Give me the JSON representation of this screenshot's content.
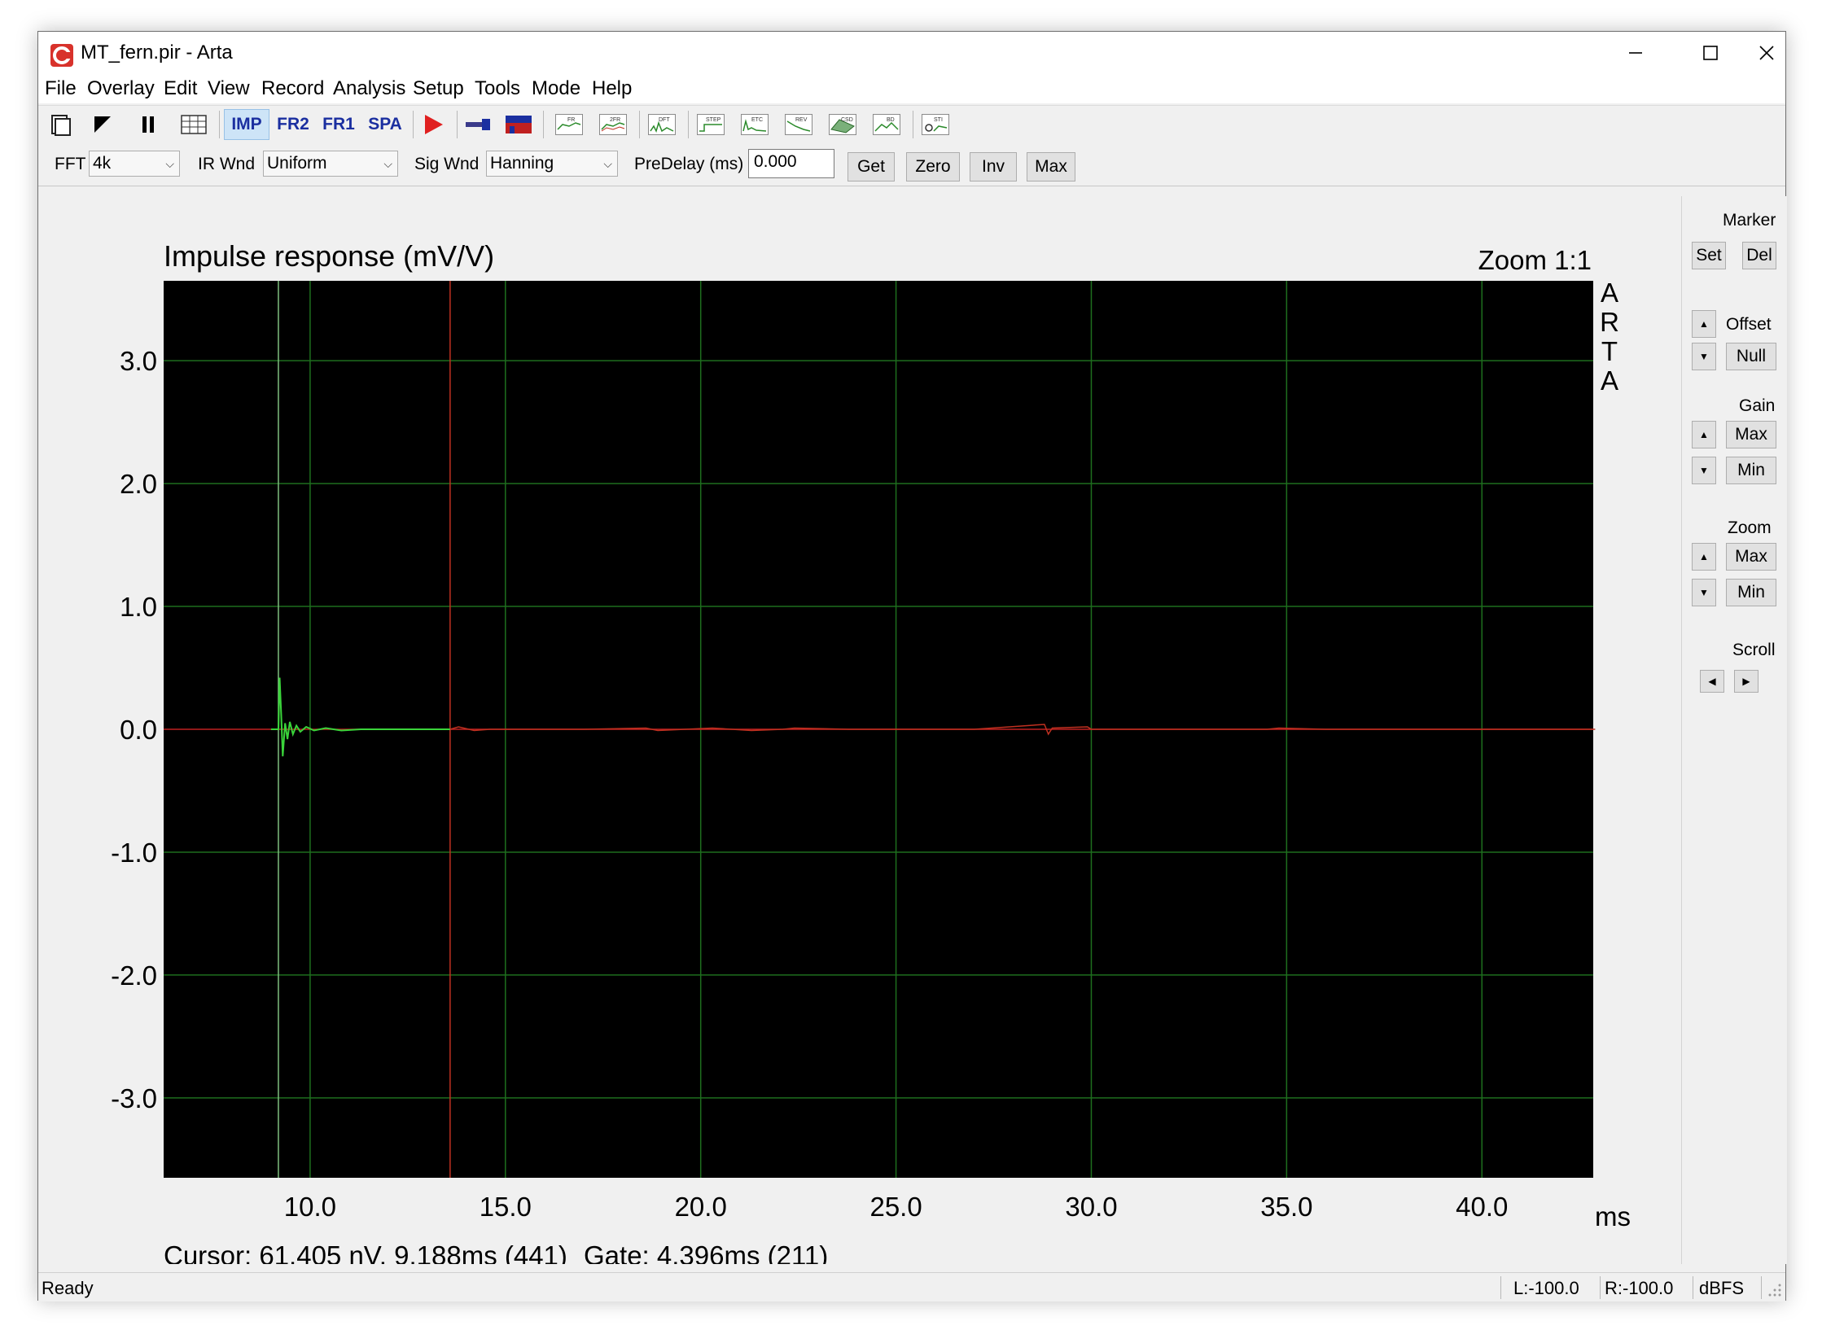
{
  "window": {
    "title": "MT_fern.pir - Arta"
  },
  "menu": [
    "File",
    "Overlay",
    "Edit",
    "View",
    "Record",
    "Analysis",
    "Setup",
    "Tools",
    "Mode",
    "Help"
  ],
  "toolbar": {
    "mode_buttons": [
      "IMP",
      "FR2",
      "FR1",
      "SPA"
    ],
    "active_mode": "IMP",
    "chart_buttons": [
      "FR",
      "2FR",
      "DFT",
      "STEP",
      "ETC",
      "REV",
      "CSD",
      "BD",
      "STI"
    ]
  },
  "params": {
    "fft_label": "FFT",
    "fft_value": "4k",
    "irwnd_label": "IR Wnd",
    "irwnd_value": "Uniform",
    "sigwnd_label": "Sig Wnd",
    "sigwnd_value": "Hanning",
    "predelay_label": "PreDelay (ms)",
    "predelay_value": "0.000",
    "get": "Get",
    "zero": "Zero",
    "inv": "Inv",
    "max": "Max"
  },
  "plot": {
    "title": "Impulse response (mV/V)",
    "zoom": "Zoom 1:1",
    "x_unit": "ms",
    "watermark": [
      "A",
      "R",
      "T",
      "A"
    ],
    "cursor_readout": "Cursor: 61.405 nV, 9.188ms (441)",
    "gate_readout": "Gate: 4.396ms (211)",
    "colors": {
      "background": "#000000",
      "grid": "#1e6e1e",
      "pre_gate": "#3ad43a",
      "post_gate": "#c03020",
      "axis_zero": "#c02020"
    }
  },
  "chart_data": {
    "type": "line",
    "title": "Impulse response (mV/V)",
    "xlabel": "ms",
    "ylabel": "",
    "xlim": [
      6.25,
      42.85
    ],
    "ylim": [
      -3.65,
      3.65
    ],
    "x_ticks": [
      "10.0",
      "15.0",
      "20.0",
      "25.0",
      "30.0",
      "35.0",
      "40.0"
    ],
    "y_ticks": [
      "3.0",
      "2.0",
      "1.0",
      "0.0",
      "-1.0",
      "-2.0",
      "-3.0"
    ],
    "cursor_x_ms": 9.188,
    "gate_x_ms": 13.584,
    "grid": true,
    "x": [
      9.0,
      9.15,
      9.188,
      9.22,
      9.26,
      9.3,
      9.36,
      9.42,
      9.48,
      9.56,
      9.65,
      9.75,
      9.9,
      10.1,
      10.4,
      10.8,
      11.3,
      12.0,
      13.0,
      13.584,
      13.8,
      14.2,
      14.6,
      15.5,
      17.0,
      18.6,
      18.9,
      20.3,
      21.3,
      22.1,
      22.4,
      23.8,
      25.0,
      27.0,
      28.8,
      28.9,
      29.0,
      29.9,
      30.0,
      32.0,
      34.5,
      34.8,
      36.0,
      38.0,
      40.0,
      41.5,
      42.9
    ],
    "y": [
      0.0,
      0.0,
      0.0,
      0.42,
      0.12,
      -0.22,
      0.05,
      -0.08,
      0.06,
      -0.04,
      0.03,
      -0.02,
      0.02,
      -0.01,
      0.01,
      -0.01,
      0.0,
      0.0,
      0.0,
      0.0,
      0.02,
      -0.01,
      0.0,
      0.0,
      0.0,
      0.01,
      -0.01,
      0.01,
      -0.01,
      0.0,
      0.01,
      0.0,
      0.0,
      0.0,
      0.04,
      -0.04,
      0.01,
      0.02,
      0.0,
      0.0,
      0.0,
      0.01,
      0.0,
      0.0,
      0.0,
      0.0,
      0.0
    ]
  },
  "right_panel": {
    "marker_label": "Marker",
    "set": "Set",
    "del": "Del",
    "offset_label": "Offset",
    "null": "Null",
    "gain_label": "Gain",
    "gain_max": "Max",
    "gain_min": "Min",
    "zoom_label": "Zoom",
    "zoom_max": "Max",
    "zoom_min": "Min",
    "scroll_label": "Scroll"
  },
  "status": {
    "ready": "Ready",
    "left": "L:-100.0",
    "right": "R:-100.0",
    "unit": "dBFS"
  }
}
